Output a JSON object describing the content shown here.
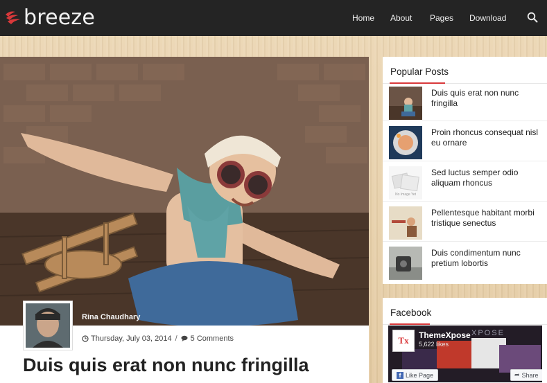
{
  "site": {
    "logo_text": "breeze"
  },
  "nav": {
    "items": [
      {
        "label": "Home"
      },
      {
        "label": "About"
      },
      {
        "label": "Pages"
      },
      {
        "label": "Download"
      }
    ]
  },
  "post": {
    "author": "Rina Chaudhary",
    "date": "Thursday, July 03, 2014",
    "comments": "5 Comments",
    "title": "Duis quis erat non nunc fringilla"
  },
  "popular_posts": {
    "title": "Popular Posts",
    "items": [
      {
        "title": "Duis quis erat non nunc fringilla"
      },
      {
        "title": "Proin rhoncus consequat nisl eu ornare"
      },
      {
        "title": "Sed luctus semper odio aliquam rhoncus"
      },
      {
        "title": "Pellentesque habitant morbi tristique senectus"
      },
      {
        "title": "Duis condimentum nunc pretium lobortis"
      }
    ]
  },
  "facebook": {
    "title": "Facebook",
    "page_name": "ThemeXpose",
    "likes": "5,622 likes",
    "like_button": "Like Page",
    "share_button": "Share",
    "logo_text": "Tx",
    "banner_text": "XPOSE",
    "no_image_text": "No Image Yet"
  },
  "colors": {
    "header_bg": "#242424",
    "accent": "#d9383a",
    "facebook_blue": "#4267b2"
  }
}
